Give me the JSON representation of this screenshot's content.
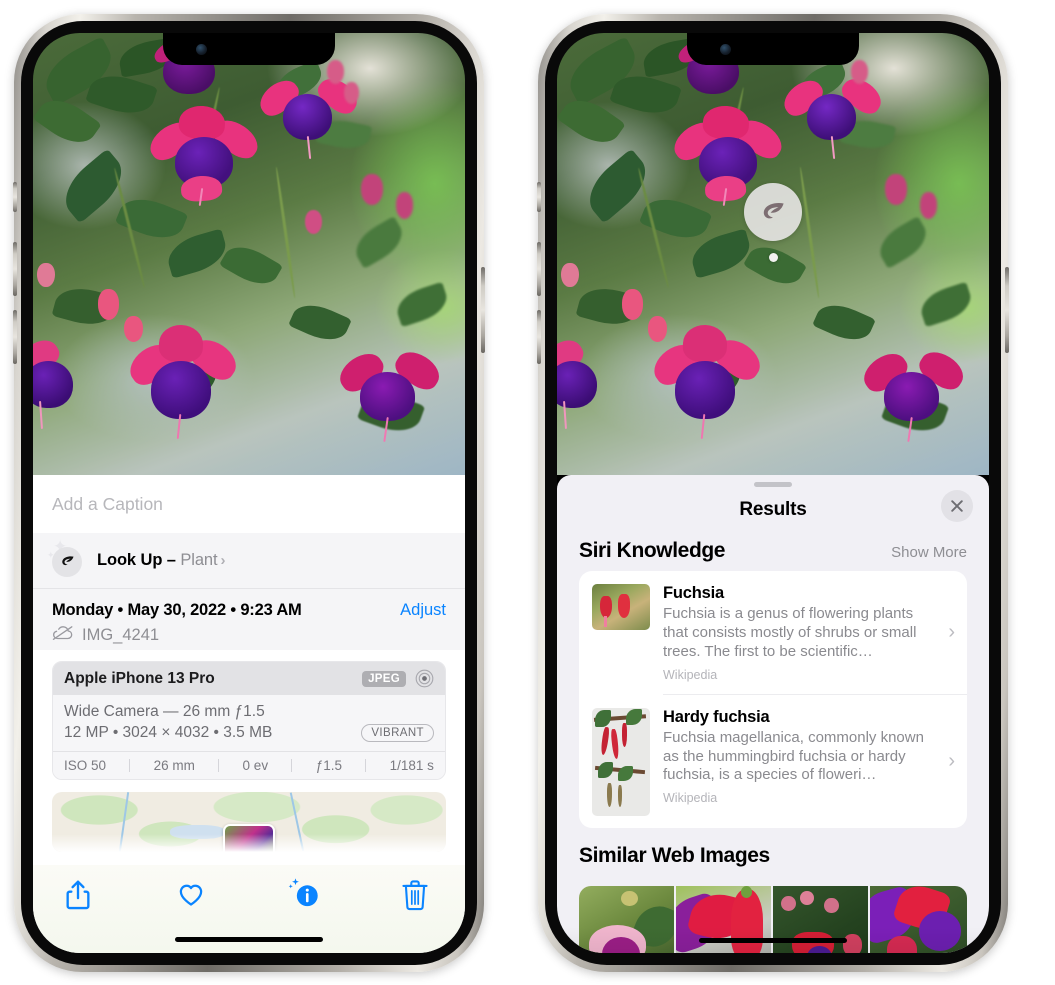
{
  "left_phone": {
    "photo_alt": "fuchsia-flowers-photo",
    "caption": {
      "placeholder": "Add a Caption",
      "value": ""
    },
    "lookup": {
      "icon": "leaf-icon",
      "sparkle_icon": "sparkles-icon",
      "label": "Look Up – ",
      "subject": "Plant",
      "chevron": "›"
    },
    "meta": {
      "date": "Monday • May 30, 2022 • 9:23 AM",
      "adjust_label": "Adjust",
      "cloud_icon": "icloud-slash-icon",
      "filename": "IMG_4241"
    },
    "exif": {
      "model": "Apple iPhone 13 Pro",
      "format_badge": "JPEG",
      "lens_icon": "camera-lens-icon",
      "lens_line": "Wide Camera — 26 mm ƒ1.5",
      "size_line": "12 MP • 3024 × 4032 • 3.5 MB",
      "style_badge": "VIBRANT",
      "stats": [
        "ISO 50",
        "26 mm",
        "0 ev",
        "ƒ1.5",
        "1/181 s"
      ]
    },
    "map": {
      "alt": "location-map-thumbnail",
      "pin": "photo-pin"
    },
    "toolbar": [
      {
        "name": "share-button",
        "icon": "share-icon"
      },
      {
        "name": "favorite-button",
        "icon": "heart-icon"
      },
      {
        "name": "info-button",
        "icon": "info-sparkle-icon"
      },
      {
        "name": "delete-button",
        "icon": "trash-icon"
      }
    ],
    "accent_color": "#0a84ff"
  },
  "right_phone": {
    "photo_alt": "fuchsia-flowers-photo",
    "visual_lookup_badge": {
      "icon": "leaf-icon",
      "dot": "indicator-dot"
    },
    "sheet": {
      "title": "Results",
      "close_icon": "close-icon",
      "grabber": "drag-handle",
      "siri_knowledge": {
        "title": "Siri Knowledge",
        "action": "Show More",
        "items": [
          {
            "thumb": "fuchsia-thumbnail",
            "title": "Fuchsia",
            "description": "Fuchsia is a genus of flowering plants that consists mostly of shrubs or small trees. The first to be scientific…",
            "source": "Wikipedia",
            "chevron": "›"
          },
          {
            "thumb": "hardy-fuchsia-thumbnail",
            "title": "Hardy fuchsia",
            "description": "Fuchsia magellanica, commonly known as the hummingbird fuchsia or hardy fuchsia, is a species of floweri…",
            "source": "Wikipedia",
            "chevron": "›"
          }
        ]
      },
      "similar_web_images": {
        "title": "Similar Web Images",
        "items": [
          {
            "alt": "fuchsia-web-image-1"
          },
          {
            "alt": "fuchsia-web-image-2"
          },
          {
            "alt": "fuchsia-web-image-3"
          },
          {
            "alt": "fuchsia-web-image-4"
          }
        ]
      }
    }
  }
}
